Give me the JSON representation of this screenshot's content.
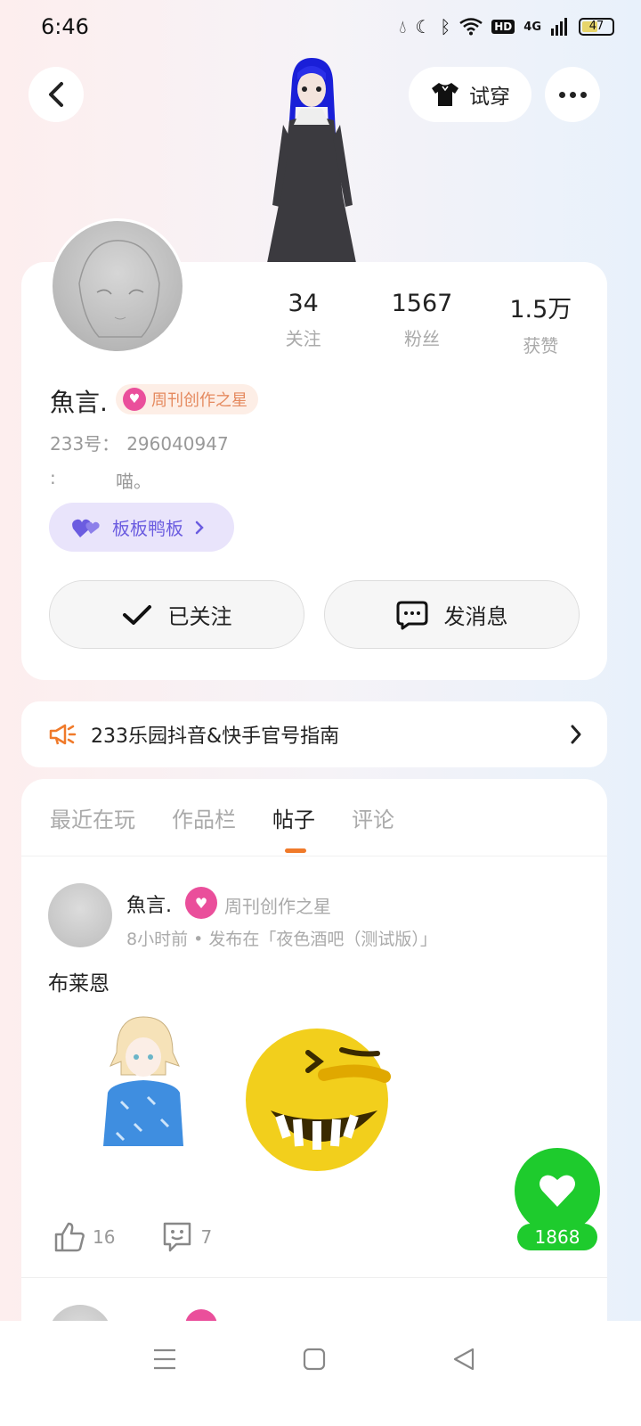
{
  "status_bar": {
    "time": "6:46",
    "battery": "47",
    "network": "4G",
    "hd": "HD"
  },
  "header": {
    "tryon_label": "试穿"
  },
  "profile": {
    "stats": [
      {
        "value": "34",
        "label": "关注"
      },
      {
        "value": "1567",
        "label": "粉丝"
      },
      {
        "value": "1.5万",
        "label": "获赞"
      }
    ],
    "username": "魚言.",
    "badge": "周刊创作之星",
    "uid_label": "233号：",
    "uid": "296040947",
    "signature_label": ":",
    "signature": "喵。",
    "group_chip": "板板鸭板",
    "follow_label": "已关注",
    "message_label": "发消息"
  },
  "notice": {
    "text": "233乐园抖音&快手官号指南"
  },
  "tabs": [
    {
      "label": "最近在玩"
    },
    {
      "label": "作品栏"
    },
    {
      "label": "帖子"
    },
    {
      "label": "评论"
    }
  ],
  "active_tab": "帖子",
  "post": {
    "author": "魚言.",
    "badge": "周刊创作之星",
    "meta": "8小时前 • 发布在「夜色酒吧（测试版）」",
    "text": "布莱恩",
    "likes": "16",
    "comments": "7"
  },
  "like_fab": {
    "count": "1868"
  },
  "colors": {
    "accent": "#f07a2a",
    "fab_green": "#1ecb2d",
    "badge_pink": "#ea4f9b",
    "chip_purple": "#6b5ce0"
  }
}
